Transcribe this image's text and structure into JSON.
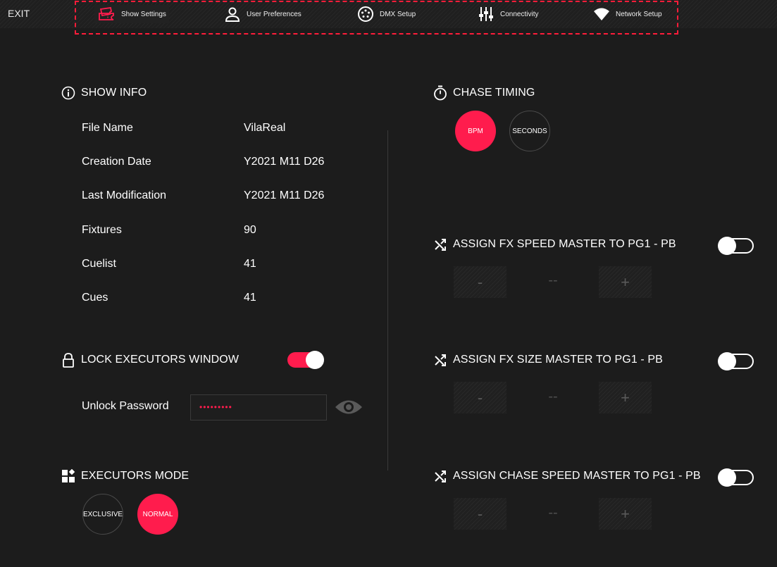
{
  "top_nav": {
    "exit_label": "EXIT",
    "items": [
      {
        "label": "Show Settings",
        "icon": "ticket-icon",
        "active": true
      },
      {
        "label": "User Preferences",
        "icon": "user-icon"
      },
      {
        "label": "DMX Setup",
        "icon": "dmx-connector-icon"
      },
      {
        "label": "Connectivity",
        "icon": "faders-icon"
      },
      {
        "label": "Network Setup",
        "icon": "wifi-icon"
      }
    ]
  },
  "show_info": {
    "title": "SHOW INFO",
    "rows": [
      {
        "label": "File Name",
        "value": "VilaReal"
      },
      {
        "label": "Creation Date",
        "value": "Y2021 M11 D26"
      },
      {
        "label": "Last Modification",
        "value": "Y2021 M11 D26"
      },
      {
        "label": "Fixtures",
        "value": "90"
      },
      {
        "label": "Cuelist",
        "value": "41"
      },
      {
        "label": "Cues",
        "value": "41"
      }
    ]
  },
  "lock": {
    "title": "LOCK EXECUTORS WINDOW",
    "enabled": true,
    "password_label": "Unlock Password",
    "password_value": "•••••••••"
  },
  "executors_mode": {
    "title": "EXECUTORS MODE",
    "options": [
      "EXCLUSIVE",
      "NORMAL"
    ],
    "selected": "NORMAL"
  },
  "chase_timing": {
    "title": "CHASE TIMING",
    "options": [
      "BPM",
      "SECONDS"
    ],
    "selected": "BPM"
  },
  "assignments": [
    {
      "title": "ASSIGN FX SPEED MASTER TO PG1 - PB",
      "enabled": false,
      "minus": "-",
      "value": "--",
      "plus": "+"
    },
    {
      "title": "ASSIGN FX SIZE MASTER TO PG1 - PB",
      "enabled": false,
      "minus": "-",
      "value": "--",
      "plus": "+"
    },
    {
      "title": "ASSIGN CHASE SPEED MASTER TO PG1 - PB",
      "enabled": false,
      "minus": "-",
      "value": "--",
      "plus": "+"
    }
  ],
  "colors": {
    "accent": "#ff1c4d",
    "background": "#1c1c1c",
    "highlight_border": "#ff1c3a"
  }
}
